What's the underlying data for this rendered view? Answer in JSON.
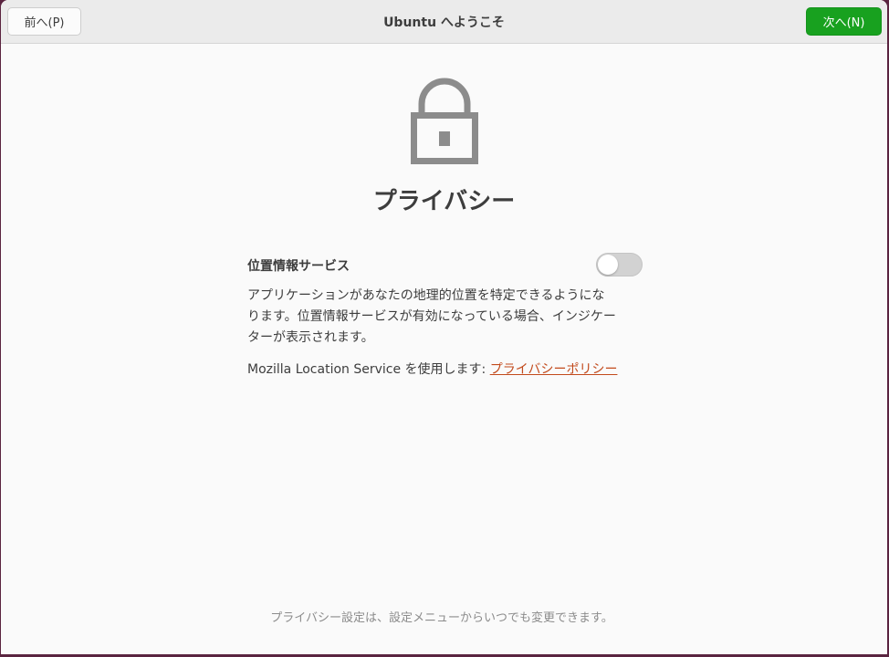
{
  "header": {
    "title": "Ubuntu へようこそ",
    "back_label": "前へ(P)",
    "next_label": "次へ(N)"
  },
  "main": {
    "icon": "lock-icon",
    "title": "プライバシー",
    "location_services": {
      "label": "位置情報サービス",
      "enabled": false,
      "description_lines": [
        "アプリケーションがあなたの地理的位置を特定できるようにな",
        "ります。位置情報サービスが有効になっている場合、インジケー",
        "ターが表示されます。"
      ],
      "provider_text": "Mozilla Location Service を使用します: ",
      "privacy_policy_link": "プライバシーポリシー"
    },
    "footer_note": "プライバシー設定は、設定メニューからいつでも変更できます。"
  },
  "colors": {
    "accent_green": "#18a11f",
    "link_orange": "#c24a1c",
    "desktop_background": "#5a2440"
  }
}
